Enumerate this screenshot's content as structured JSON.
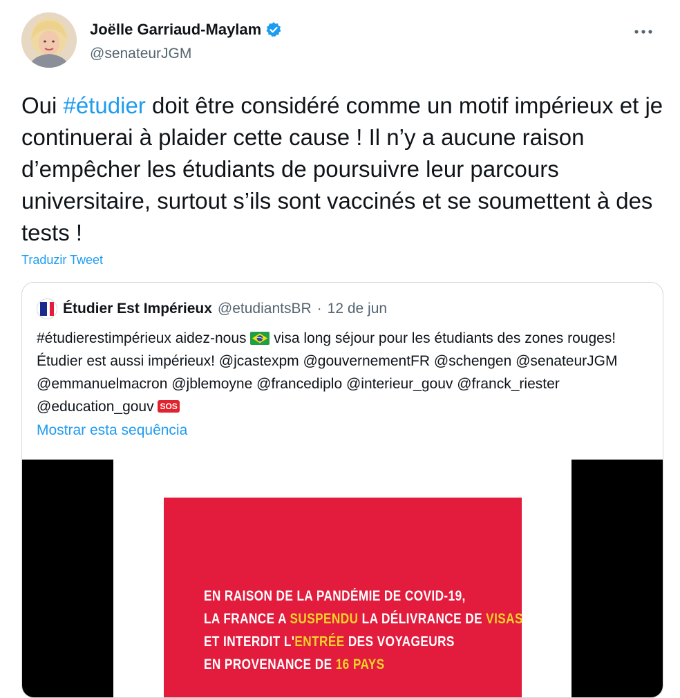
{
  "author": {
    "display_name": "Joëlle Garriaud-Maylam",
    "handle": "@senateurJGM",
    "verified": true,
    "avatar": "author-avatar"
  },
  "more_icon": "more-icon",
  "tweet": {
    "text_before": "Oui ",
    "hashtag": "#étudier",
    "text_after": " doit être considéré comme un motif impérieux et je continuerai à plaider cette cause !  Il n’y a aucune raison d’empêcher les étudiants de poursuivre leur parcours universitaire, surtout s’ils sont vaccinés et se soumettent à des tests  !",
    "translate_label": "Traduzir Tweet"
  },
  "quoted": {
    "name": "Étudier Est Impérieux",
    "handle": "@etudiantsBR",
    "separator": "·",
    "date": "12 de jun",
    "text_part1": "#étudierestimpérieux aidez-nous ",
    "text_part2": " visa long séjour pour les étudiants des zones rouges! Étudier est aussi impérieux! @jcastexpm @gouvernementFR @schengen @senateurJGM @emmanuelmacron @jblemoyne @francediplo @interieur_gouv @franck_riester @education_gouv ",
    "sos_label": "SOS",
    "thread_label": "Mostrar esta sequência",
    "media": {
      "line1": "EN RAISON DE LA PANDÉMIE DE COVID-19,",
      "line2_a": "LA FRANCE A ",
      "line2_b": "SUSPENDU",
      "line2_c": " LA DÉLIVRANCE DE ",
      "line2_d": "VISAS",
      "line3_a": "ET INTERDIT L'",
      "line3_b": "ENTRÉE",
      "line3_c": " DES VOYAGEURS",
      "line4_a": "EN PROVENANCE DE ",
      "line4_b": "16 PAYS"
    }
  },
  "colors": {
    "link": "#1d9bf0",
    "card_red": "#e31b3c",
    "highlight_yellow": "#f5d32b",
    "muted": "#536471"
  }
}
